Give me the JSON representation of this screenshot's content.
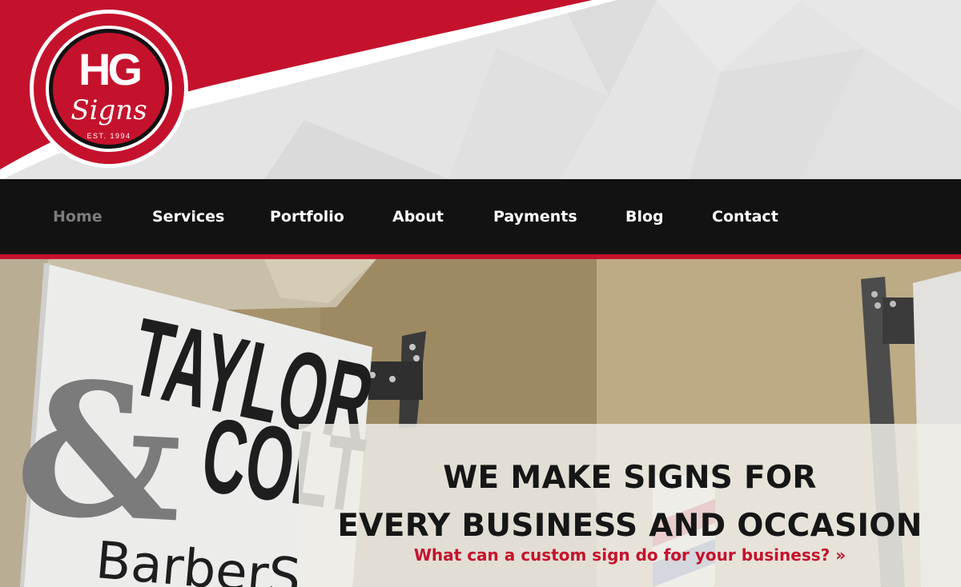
{
  "brand": {
    "logo_letters": "HG",
    "logo_script": "Signs",
    "logo_est": "EST. 1994",
    "red": "#c5122c",
    "black": "#121212"
  },
  "nav": {
    "items": [
      {
        "label": "Home",
        "active": true
      },
      {
        "label": "Services",
        "active": false
      },
      {
        "label": "Portfolio",
        "active": false
      },
      {
        "label": "About",
        "active": false
      },
      {
        "label": "Payments",
        "active": false
      },
      {
        "label": "Blog",
        "active": false
      },
      {
        "label": "Contact",
        "active": false
      }
    ]
  },
  "hero": {
    "title_line1": "WE MAKE SIGNS FOR",
    "title_line2": "EVERY BUSINESS AND OCCASION",
    "cta": "What can a custom sign do for your business? »",
    "photo_sign": {
      "line1": "TAYLOR",
      "line2": "COLT",
      "ampersand": "&",
      "line3": "BarberS"
    }
  }
}
